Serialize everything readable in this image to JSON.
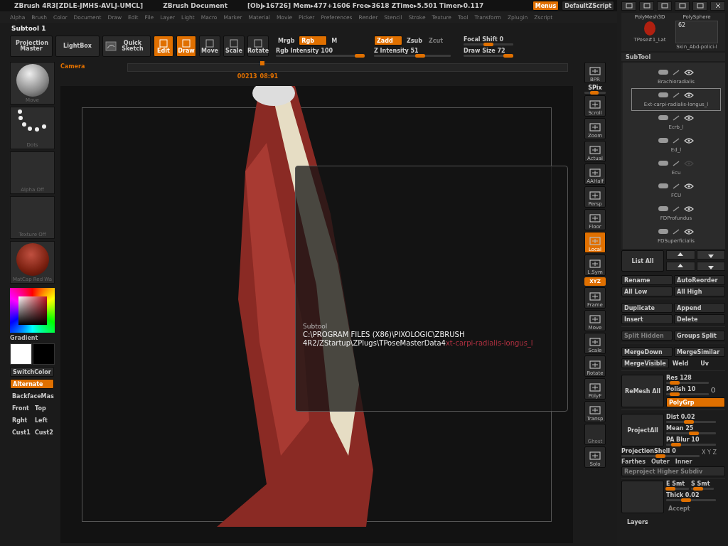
{
  "title_bar": {
    "app": "ZBrush 4R3[ZDLE-JMHS-AVLJ-UMCL]",
    "document": "ZBrush Document",
    "stats": "[Obj▸16726] Mem▸477+1606 Free▸3618 ZTime▸5.501 Timer▸0.117",
    "menus_button": "Menus",
    "script": "DefaultZScript"
  },
  "menu_bar": [
    "Alpha",
    "Brush",
    "Color",
    "Document",
    "Draw",
    "Edit",
    "File",
    "Layer",
    "Light",
    "Macro",
    "Marker",
    "Material",
    "Movie",
    "Picker",
    "Preferences",
    "Render",
    "Stencil",
    "Stroke",
    "Texture",
    "Tool",
    "Transform",
    "Zplugin",
    "Zscript"
  ],
  "subtool_label": "Subtool 1",
  "toolbar": {
    "buttons": [
      {
        "label": "Projection Master",
        "kind": "text"
      },
      {
        "label": "LightBox",
        "kind": "text"
      },
      {
        "label": "Quick Sketch",
        "kind": "icon"
      }
    ],
    "modes": [
      {
        "label": "Edit",
        "selected": true
      },
      {
        "label": "Draw",
        "selected": true
      },
      {
        "label": "Move",
        "selected": false
      },
      {
        "label": "Scale",
        "selected": false
      },
      {
        "label": "Rotate",
        "selected": false
      }
    ],
    "color_toggles": [
      {
        "label": "Mrgb",
        "on": false,
        "disabled": false
      },
      {
        "label": "Rgb",
        "on": true,
        "disabled": false
      },
      {
        "label": "M",
        "on": false,
        "disabled": false
      }
    ],
    "z_toggles": [
      {
        "label": "Zadd",
        "on": true,
        "disabled": false
      },
      {
        "label": "Zsub",
        "on": false,
        "disabled": false
      },
      {
        "label": "Zcut",
        "on": false,
        "disabled": true
      }
    ],
    "sliders": [
      {
        "label": "Rgb Intensity 100",
        "level": 0.95
      },
      {
        "label": "Z Intensity 51",
        "level": 0.6
      },
      {
        "label": "Focal Shift 0",
        "level": 0.5
      },
      {
        "label": "Draw Size 72",
        "level": 0.9
      }
    ]
  },
  "left_shelf": {
    "thumbnails": [
      {
        "label": "Move",
        "kind": "brush"
      },
      {
        "label": "Dots",
        "kind": "stroke"
      },
      {
        "label": "Alpha Off",
        "kind": "empty"
      },
      {
        "label": "Texture Off",
        "kind": "empty"
      },
      {
        "label": "MatCap Red Wa",
        "kind": "material"
      }
    ],
    "gradient_label": "Gradient",
    "switch_color": "SwitchColor",
    "toggles": [
      {
        "label": "Alternate",
        "on": true
      },
      {
        "label": "BackfaceMas",
        "on": false
      }
    ],
    "view_buttons": [
      [
        "Front",
        "Top"
      ],
      [
        "Rght",
        "Left"
      ],
      [
        "Cust1",
        "Cust2"
      ]
    ]
  },
  "timeline": {
    "label": "Camera",
    "frame": "00213",
    "time": "08:91",
    "level": 0.3
  },
  "tooltip": {
    "title": "Subtool",
    "path_lines": [
      "C:\\PROGRAM FILES (X86)\\PIXOLOGIC\\ZBRUSH"
    ],
    "path_last": "4R2/ZStartup\\ZPlugs\\TPoseMasterData4",
    "path_tail": "xt-carpi-radialis-longus_l"
  },
  "tool_strip": [
    {
      "label": "BPR",
      "kind": "button",
      "on": false
    },
    {
      "label": "SPix",
      "kind": "slider"
    },
    {
      "label": "Scroll",
      "kind": "button",
      "on": false
    },
    {
      "label": "Zoom",
      "kind": "button",
      "on": false
    },
    {
      "label": "Actual",
      "kind": "button",
      "on": false
    },
    {
      "label": "AAHalf",
      "kind": "button",
      "on": false
    },
    {
      "label": "Persp",
      "kind": "button",
      "on": false
    },
    {
      "label": "Floor",
      "kind": "button",
      "on": false
    },
    {
      "label": "Local",
      "kind": "button",
      "on": true
    },
    {
      "label": "L.Sym",
      "kind": "button",
      "on": false
    },
    {
      "label": "XYZ",
      "kind": "pill",
      "on": true
    },
    {
      "label": "Frame",
      "kind": "button",
      "on": false
    },
    {
      "label": "Move",
      "kind": "button",
      "on": false
    },
    {
      "label": "Scale",
      "kind": "button",
      "on": false
    },
    {
      "label": "Rotate",
      "kind": "button",
      "on": false
    },
    {
      "label": "PolyF",
      "kind": "button",
      "on": false
    },
    {
      "label": "Transp",
      "kind": "button",
      "on": false
    },
    {
      "label": "Ghost",
      "kind": "disabled",
      "on": false
    },
    {
      "label": "Solo",
      "kind": "button",
      "on": false
    }
  ],
  "tool_panel": {
    "thumbs": [
      {
        "label": "PolyMesh3D",
        "caption": "TPose#1_Lat",
        "kind": "mesh"
      },
      {
        "label": "PolySphere",
        "caption": "Skin_Abd-polici-l",
        "kind": "count",
        "count": "62"
      }
    ]
  },
  "subtool": {
    "header": "SubTool",
    "items": [
      {
        "name": "Brachioradialis",
        "selected": false,
        "visible": true
      },
      {
        "name": "Ext-carpi-radialis-longus_l",
        "selected": true,
        "visible": true
      },
      {
        "name": "Ecrb_l",
        "selected": false,
        "visible": true
      },
      {
        "name": "Ed_l",
        "selected": false,
        "visible": true
      },
      {
        "name": "Ecu",
        "selected": false,
        "visible": false
      },
      {
        "name": "FCU",
        "selected": false,
        "visible": true
      },
      {
        "name": "FDProfundus",
        "selected": false,
        "visible": true
      },
      {
        "name": "FDSuperficialis",
        "selected": false,
        "visible": true
      }
    ],
    "list_all": "List All",
    "button_groups": [
      [
        [
          {
            "label": "Rename",
            "disabled": false
          },
          {
            "label": "AutoReorder",
            "disabled": false
          }
        ],
        [
          {
            "label": "All Low",
            "disabled": false
          },
          {
            "label": "All High",
            "disabled": false
          }
        ]
      ],
      [
        [
          {
            "label": "Duplicate",
            "disabled": false
          },
          {
            "label": "Append",
            "disabled": false
          }
        ],
        [
          {
            "label": "Insert",
            "disabled": false
          },
          {
            "label": "Delete",
            "disabled": false
          }
        ]
      ],
      [
        [
          {
            "label": "Split Hidden",
            "disabled": true
          },
          {
            "label": "Groups Split",
            "disabled": false
          }
        ]
      ],
      [
        [
          {
            "label": "MergeDown",
            "disabled": false
          },
          {
            "label": "MergeSimilar",
            "disabled": false
          }
        ],
        [
          {
            "label": "MergeVisible",
            "disabled": false
          },
          {
            "label": "Weld",
            "disabled": false
          },
          {
            "label": "Uv",
            "disabled": false
          }
        ]
      ]
    ],
    "remesh": {
      "button": "ReMesh All",
      "sliders": [
        {
          "label": "Res 128",
          "level": 0.2
        },
        {
          "label": "Polish 10",
          "level": 0.2
        }
      ],
      "circle": "O",
      "toggle": {
        "label": "PolyGrp",
        "on": true
      }
    },
    "project": {
      "button": "ProjectAll",
      "sliders": [
        {
          "label": "Dist 0.02",
          "level": 0.45
        },
        {
          "label": "Mean 25",
          "level": 0.55
        },
        {
          "label": "PA Blur 10",
          "level": 0.2
        }
      ]
    },
    "shell": {
      "label": "ProjectionShell 0",
      "level": 0.5,
      "axes": "X Y Z"
    },
    "shell_options": [
      "Farthes",
      "Outer",
      "Inner"
    ],
    "reproject": "Reproject Higher Subdiv",
    "extract": {
      "sliders": [
        {
          "label": "E Smt",
          "level": 0.2
        },
        {
          "label": "S Smt",
          "level": 0.3
        },
        {
          "label": "Thick 0.02",
          "level": 0.4
        }
      ],
      "accept": "Accept"
    },
    "footer": "Layers"
  }
}
